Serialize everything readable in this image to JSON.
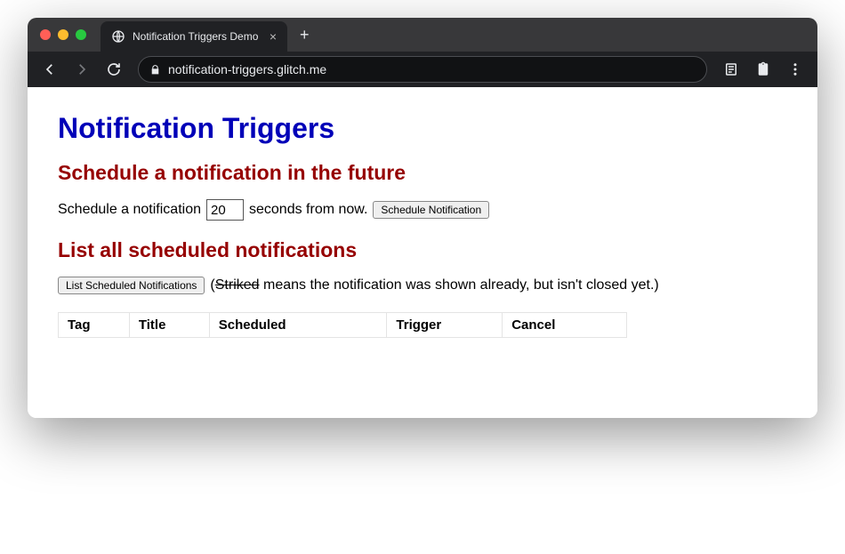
{
  "browser": {
    "tab_title": "Notification Triggers Demo",
    "url": "notification-triggers.glitch.me"
  },
  "page": {
    "h1": "Notification Triggers",
    "schedule": {
      "heading": "Schedule a notification in the future",
      "prefix": "Schedule a notification",
      "value": "20",
      "suffix": "seconds from now.",
      "button": "Schedule Notification"
    },
    "list": {
      "heading": "List all scheduled notifications",
      "button": "List Scheduled Notifications",
      "note_open": "(",
      "note_striked": "Striked",
      "note_rest": " means the notification was shown already, but isn't closed yet.)",
      "columns": {
        "tag": "Tag",
        "title": "Title",
        "scheduled": "Scheduled",
        "trigger": "Trigger",
        "cancel": "Cancel"
      }
    }
  }
}
